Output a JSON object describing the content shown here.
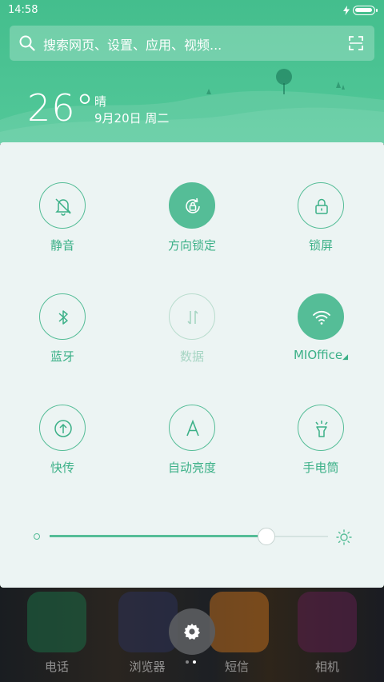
{
  "status_bar": {
    "time": "14:58"
  },
  "search": {
    "placeholder": "搜索网页、设置、应用、视频..."
  },
  "weather": {
    "temperature": "26°",
    "condition": "晴",
    "date": "9月20日 周二"
  },
  "toggles": [
    {
      "label": "静音",
      "icon": "bell-off-icon",
      "state": "off"
    },
    {
      "label": "方向锁定",
      "icon": "rotation-lock-icon",
      "state": "on"
    },
    {
      "label": "锁屏",
      "icon": "lock-icon",
      "state": "off"
    },
    {
      "label": "蓝牙",
      "icon": "bluetooth-icon",
      "state": "off"
    },
    {
      "label": "数据",
      "icon": "data-arrows-icon",
      "state": "disabled"
    },
    {
      "label": "MIOffice",
      "icon": "wifi-icon",
      "state": "on"
    },
    {
      "label": "快传",
      "icon": "upload-icon",
      "state": "off"
    },
    {
      "label": "自动亮度",
      "icon": "letter-a-icon",
      "state": "off"
    },
    {
      "label": "手电筒",
      "icon": "flashlight-icon",
      "state": "off"
    }
  ],
  "brightness": {
    "level": 0.78
  },
  "dock": {
    "apps": [
      {
        "label": "电话",
        "icon": "phone-icon"
      },
      {
        "label": "浏览器",
        "icon": "browser-icon"
      },
      {
        "label": "短信",
        "icon": "message-icon"
      },
      {
        "label": "相机",
        "icon": "camera-icon"
      }
    ]
  },
  "colors": {
    "accent": "#55bd97",
    "header": "#4cc494",
    "panel": "#ecf4f3"
  }
}
